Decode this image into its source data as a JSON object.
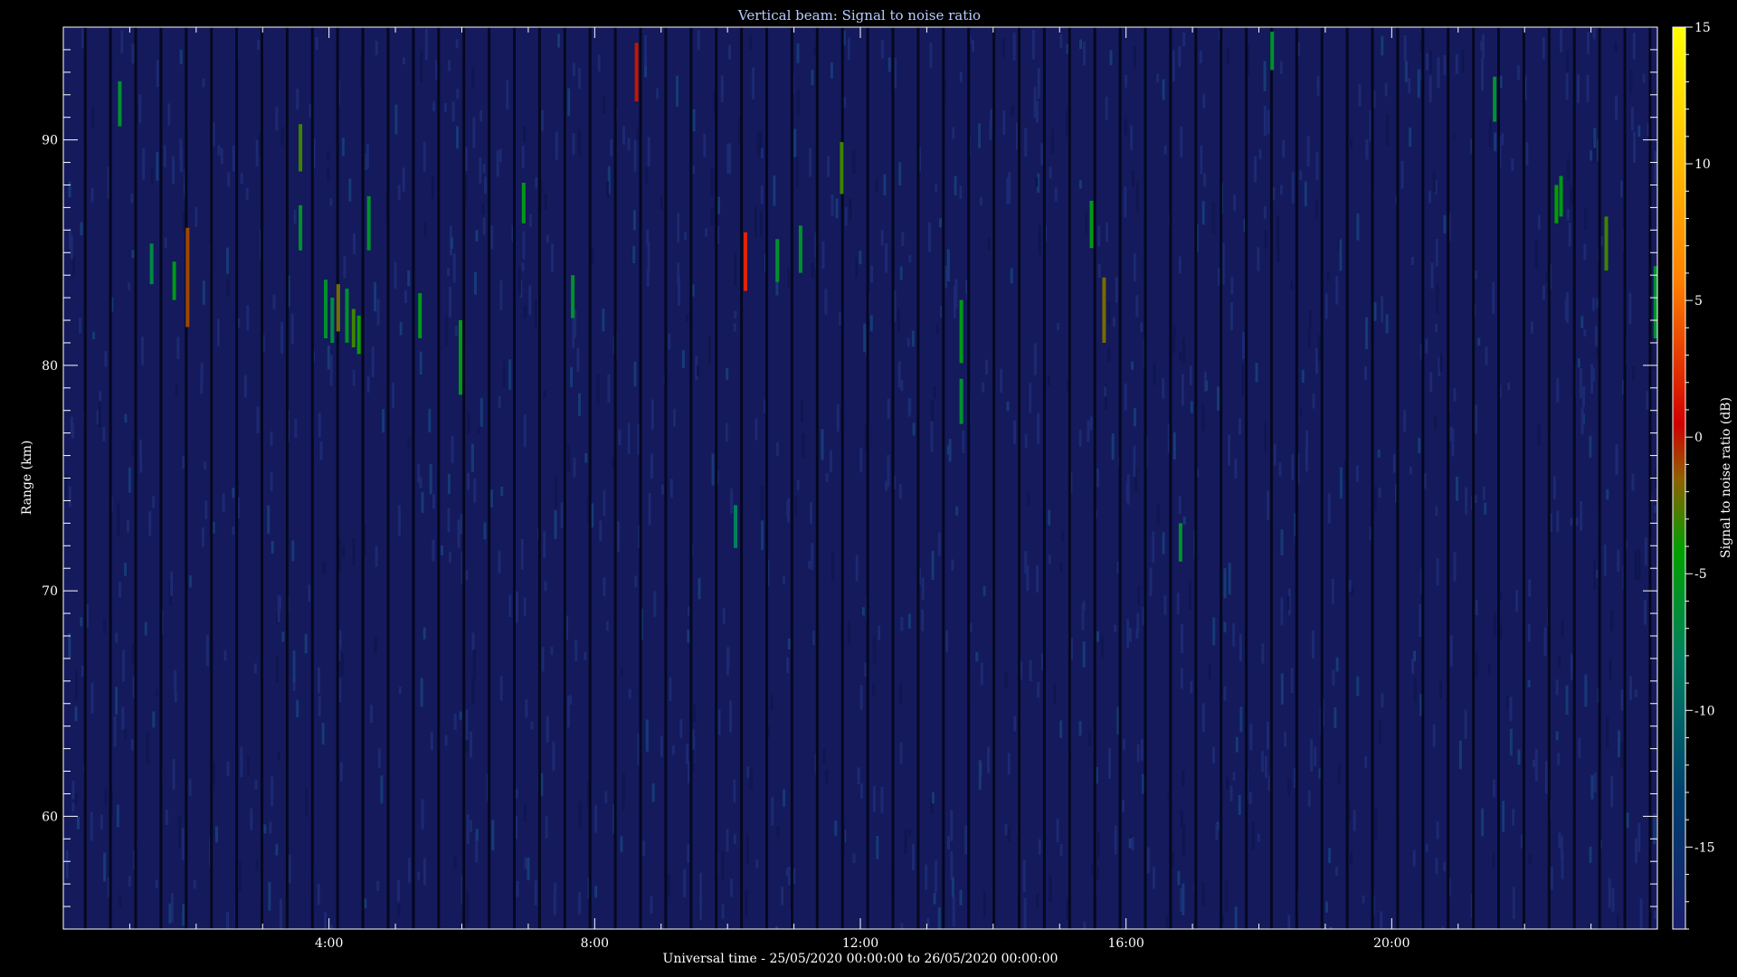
{
  "chart_data": {
    "type": "heatmap",
    "title": "Vertical beam: Signal to noise ratio",
    "xlabel": "Universal time - 25/05/2020 00:00:00 to 26/05/2020 00:00:00",
    "ylabel": "Range (km)",
    "colorbar_label": "Signal to noise ratio (dB)",
    "x_unit": "hours UT",
    "xlim": [
      0,
      24
    ],
    "ylim": [
      55,
      95
    ],
    "clim": [
      -18,
      15
    ],
    "x_ticks": [
      {
        "value": 4,
        "label": "4:00"
      },
      {
        "value": 8,
        "label": "8:00"
      },
      {
        "value": 12,
        "label": "12:00"
      },
      {
        "value": 16,
        "label": "16:00"
      },
      {
        "value": 20,
        "label": "20:00"
      }
    ],
    "y_ticks": [
      {
        "value": 60,
        "label": "60"
      },
      {
        "value": 70,
        "label": "70"
      },
      {
        "value": 80,
        "label": "80"
      },
      {
        "value": 90,
        "label": "90"
      }
    ],
    "colorbar_ticks": [
      {
        "value": 15,
        "label": "15"
      },
      {
        "value": 10,
        "label": "10"
      },
      {
        "value": 5,
        "label": "5"
      },
      {
        "value": 0,
        "label": "0"
      },
      {
        "value": -5,
        "label": "-5"
      },
      {
        "value": -10,
        "label": "-10"
      },
      {
        "value": -15,
        "label": "-15"
      }
    ],
    "background_snr_db": -16,
    "colormap": [
      "#1a1e6e",
      "#003f6e",
      "#008060",
      "#00a000",
      "#906000",
      "#d00000",
      "#ff8000",
      "#ffff00"
    ],
    "echoes": [
      {
        "t": 0.85,
        "r0": 90.6,
        "r1": 92.6,
        "snr": -6
      },
      {
        "t": 1.33,
        "r0": 83.6,
        "r1": 85.4,
        "snr": -7
      },
      {
        "t": 1.67,
        "r0": 82.9,
        "r1": 84.6,
        "snr": -5
      },
      {
        "t": 1.87,
        "r0": 81.7,
        "r1": 86.1,
        "snr": -1
      },
      {
        "t": 3.57,
        "r0": 88.6,
        "r1": 90.7,
        "snr": -3
      },
      {
        "t": 3.57,
        "r0": 85.1,
        "r1": 87.1,
        "snr": -6
      },
      {
        "t": 3.95,
        "r0": 81.2,
        "r1": 83.8,
        "snr": -6
      },
      {
        "t": 4.05,
        "r0": 81.0,
        "r1": 83.0,
        "snr": -7
      },
      {
        "t": 4.14,
        "r0": 81.5,
        "r1": 83.6,
        "snr": -2
      },
      {
        "t": 4.27,
        "r0": 81.0,
        "r1": 83.4,
        "snr": -6
      },
      {
        "t": 4.37,
        "r0": 80.8,
        "r1": 82.5,
        "snr": -3
      },
      {
        "t": 4.45,
        "r0": 80.5,
        "r1": 82.2,
        "snr": -4
      },
      {
        "t": 4.6,
        "r0": 85.1,
        "r1": 87.5,
        "snr": -6
      },
      {
        "t": 5.37,
        "r0": 81.2,
        "r1": 83.2,
        "snr": -5
      },
      {
        "t": 5.98,
        "r0": 78.7,
        "r1": 82.0,
        "snr": -5
      },
      {
        "t": 6.93,
        "r0": 86.3,
        "r1": 88.1,
        "snr": -5
      },
      {
        "t": 7.67,
        "r0": 82.1,
        "r1": 84.0,
        "snr": -6
      },
      {
        "t": 8.63,
        "r0": 91.7,
        "r1": 94.3,
        "snr": 0
      },
      {
        "t": 10.12,
        "r0": 71.9,
        "r1": 73.8,
        "snr": -8
      },
      {
        "t": 10.27,
        "r0": 83.3,
        "r1": 85.9,
        "snr": 2
      },
      {
        "t": 10.75,
        "r0": 83.7,
        "r1": 85.6,
        "snr": -6
      },
      {
        "t": 11.1,
        "r0": 84.1,
        "r1": 86.2,
        "snr": -6
      },
      {
        "t": 11.72,
        "r0": 87.6,
        "r1": 89.9,
        "snr": -3
      },
      {
        "t": 13.52,
        "r0": 80.1,
        "r1": 82.9,
        "snr": -5
      },
      {
        "t": 13.52,
        "r0": 77.4,
        "r1": 79.4,
        "snr": -6
      },
      {
        "t": 15.48,
        "r0": 85.2,
        "r1": 87.3,
        "snr": -5
      },
      {
        "t": 15.67,
        "r0": 81.0,
        "r1": 83.9,
        "snr": -2
      },
      {
        "t": 16.82,
        "r0": 71.3,
        "r1": 73.0,
        "snr": -6
      },
      {
        "t": 18.2,
        "r0": 93.1,
        "r1": 94.8,
        "snr": -6
      },
      {
        "t": 21.55,
        "r0": 90.8,
        "r1": 92.8,
        "snr": -6
      },
      {
        "t": 22.48,
        "r0": 86.3,
        "r1": 88.0,
        "snr": -4
      },
      {
        "t": 22.55,
        "r0": 86.6,
        "r1": 88.4,
        "snr": -5
      },
      {
        "t": 23.23,
        "r0": 84.2,
        "r1": 86.6,
        "snr": -3
      },
      {
        "t": 23.97,
        "r0": 81.2,
        "r1": 84.4,
        "snr": -6
      }
    ],
    "grid": false,
    "colorbar_position": "right"
  }
}
